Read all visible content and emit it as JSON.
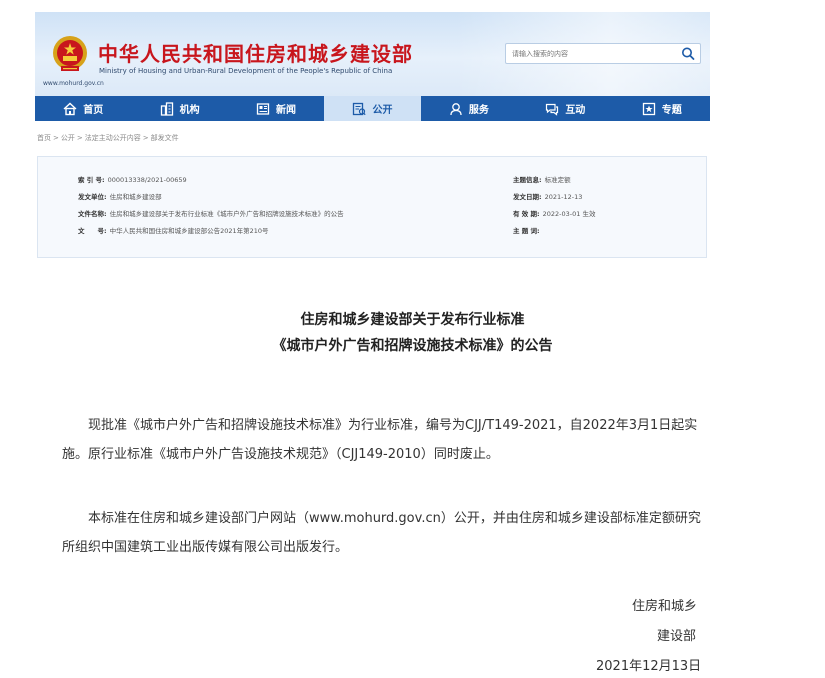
{
  "header": {
    "title": "中华人民共和国住房和城乡建设部",
    "subtitle": "Ministry of Housing and Urban-Rural Development of the People's Republic of China",
    "url": "www.mohurd.gov.cn",
    "search_placeholder": "请输入搜索的内容"
  },
  "nav": {
    "items": [
      {
        "label": "首页",
        "icon": "home-icon"
      },
      {
        "label": "机构",
        "icon": "building-icon"
      },
      {
        "label": "新闻",
        "icon": "news-icon"
      },
      {
        "label": "公开",
        "icon": "disclosure-icon",
        "active": true
      },
      {
        "label": "服务",
        "icon": "service-icon"
      },
      {
        "label": "互动",
        "icon": "chat-icon"
      },
      {
        "label": "专题",
        "icon": "topic-icon"
      }
    ]
  },
  "breadcrumb": [
    "首页",
    "公开",
    "法定主动公开内容",
    "部发文件"
  ],
  "meta": {
    "index_label": "索 引 号:",
    "index_value": "000013338/2021-00659",
    "topic_label": "主题信息:",
    "topic_value": "标准定额",
    "issuer_label": "发文单位:",
    "issuer_value": "住房和城乡建设部",
    "date_label": "发文日期:",
    "date_value": "2021-12-13",
    "docname_label": "文件名称:",
    "docname_value": "住房和城乡建设部关于发布行业标准《城市户外广告和招牌设施技术标准》的公告",
    "valid_label": "有 效 期:",
    "valid_value": "2022-03-01 生效",
    "docno_label": "文　　号:",
    "docno_value": "中华人民共和国住房和城乡建设部公告2021年第210号",
    "keywords_label": "主 题 词:",
    "keywords_value": ""
  },
  "article": {
    "title_line1": "住房和城乡建设部关于发布行业标准",
    "title_line2": "《城市户外广告和招牌设施技术标准》的公告",
    "para1": "现批准《城市户外广告和招牌设施技术标准》为行业标准，编号为CJJ/T149-2021，自2022年3月1日起实施。原行业标准《城市户外广告设施技术规范》（CJJ149-2010）同时废止。",
    "para2": "本标准在住房和城乡建设部门户网站（www.mohurd.gov.cn）公开，并由住房和城乡建设部标准定额研究所组织中国建筑工业出版传媒有限公司出版发行。",
    "sign_line1": "住房和城乡",
    "sign_line2": "建设部",
    "sign_date": "2021年12月13日"
  },
  "colors": {
    "nav_blue": "#1d5ba8",
    "title_red": "#c8161d",
    "active_tab": "#cfe1f5"
  }
}
